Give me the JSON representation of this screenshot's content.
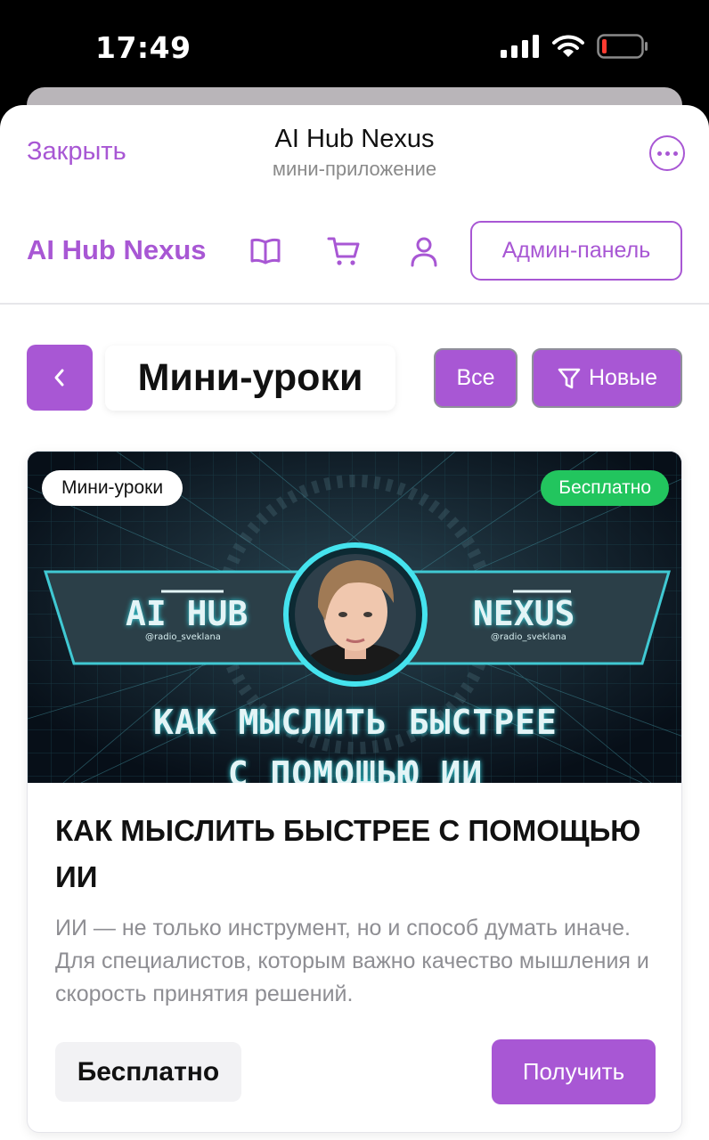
{
  "status_bar": {
    "time": "17:49"
  },
  "telegram_header": {
    "close_label": "Закрыть",
    "title": "AI Hub Nexus",
    "subtitle": "мини-приложение"
  },
  "app_header": {
    "brand": "AI Hub Nexus",
    "icons": [
      "book-icon",
      "cart-icon",
      "user-icon"
    ],
    "admin_label": "Админ-панель"
  },
  "section": {
    "title": "Мини-уроки",
    "filters": {
      "all": "Все",
      "new": "Новые"
    }
  },
  "card": {
    "category_badge": "Мини-уроки",
    "price_badge": "Бесплатно",
    "banner": {
      "left_word": "AI HUB",
      "right_word": "NEXUS",
      "handle": "@radio_sveklana",
      "headline_line1": "КАК МЫСЛИТЬ БЫСТРЕЕ",
      "headline_line2": "С ПОМОЩЬЮ ИИ"
    },
    "title": "КАК МЫСЛИТЬ БЫСТРЕЕ С ПОМОЩЬЮ ИИ",
    "description": "ИИ — не только инструмент, но и способ думать иначе. Для специалистов, которым важно качество мышления и скорость принятия решений.",
    "price": "Бесплатно",
    "action_label": "Получить"
  },
  "colors": {
    "accent": "#a857d4",
    "free_badge": "#22c55e",
    "banner_bg": "#0a1520",
    "banner_glow": "#35d6e0"
  }
}
